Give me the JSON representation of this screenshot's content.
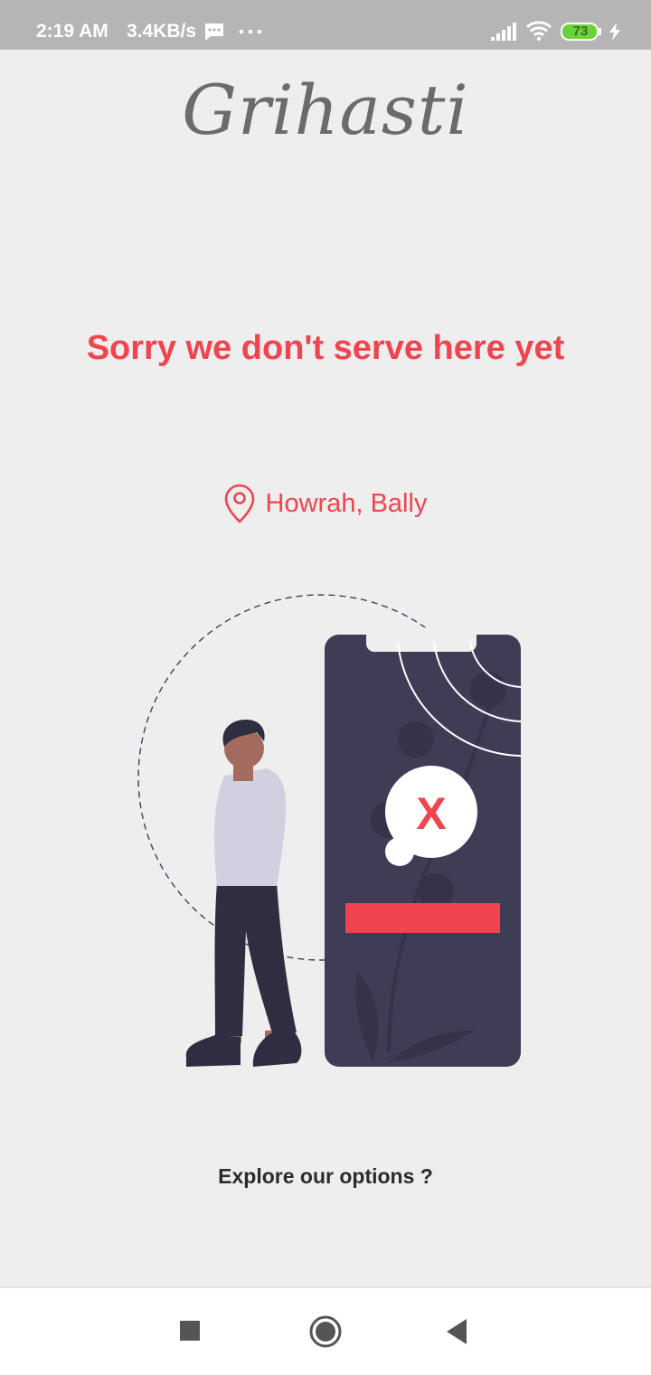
{
  "status_bar": {
    "time": "2:19 AM",
    "net_speed": "3.4KB/s",
    "battery_level": "73",
    "icons": [
      "message-icon",
      "more-dots-icon",
      "signal-icon",
      "wifi-icon",
      "battery-icon",
      "charging-icon"
    ]
  },
  "app": {
    "brand": "Grihasti"
  },
  "main": {
    "headline": "Sorry we don't serve here yet",
    "location": "Howrah, Bally",
    "explore_link": "Explore our options ?"
  },
  "colors": {
    "accent": "#f0444f",
    "phone": "#3f3d56",
    "background": "#eeeeee"
  },
  "nav_bar": {
    "icons": [
      "recent-apps-icon",
      "home-icon",
      "back-icon"
    ]
  }
}
